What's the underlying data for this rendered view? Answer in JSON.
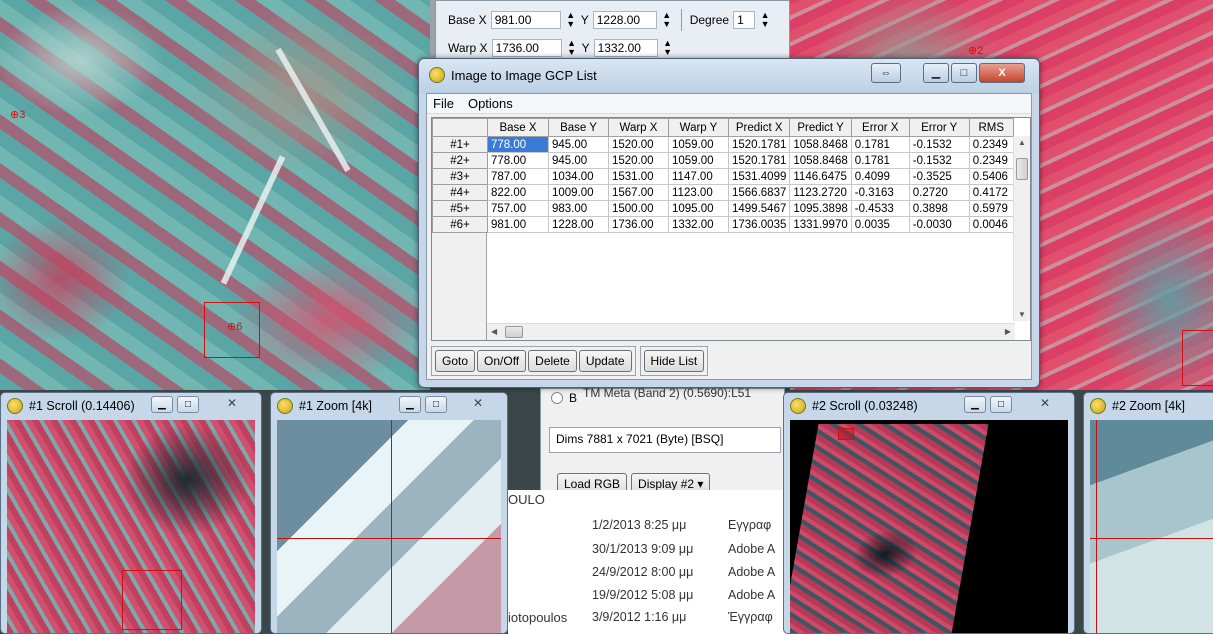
{
  "warp_dialog": {
    "base_x_label": "Base X",
    "base_x": "981.00",
    "base_y_label": "Y",
    "base_y": "1228.00",
    "degree_label": "Degree",
    "degree": "1",
    "warp_x_label": "Warp X",
    "warp_x": "1736.00",
    "warp_y_label": "Y",
    "warp_y": "1332.00"
  },
  "gcp_window": {
    "title": "Image to Image GCP List",
    "menu": [
      "File",
      "Options"
    ],
    "columns": [
      "Base X",
      "Base Y",
      "Warp X",
      "Warp Y",
      "Predict X",
      "Predict Y",
      "Error X",
      "Error Y",
      "RMS"
    ],
    "rows": [
      {
        "id": "#1+",
        "cells": [
          "778.00",
          "945.00",
          "1520.00",
          "1059.00",
          "1520.1781",
          "1058.8468",
          "0.1781",
          "-0.1532",
          "0.2349"
        ]
      },
      {
        "id": "#2+",
        "cells": [
          "778.00",
          "945.00",
          "1520.00",
          "1059.00",
          "1520.1781",
          "1058.8468",
          "0.1781",
          "-0.1532",
          "0.2349"
        ]
      },
      {
        "id": "#3+",
        "cells": [
          "787.00",
          "1034.00",
          "1531.00",
          "1147.00",
          "1531.4099",
          "1146.6475",
          "0.4099",
          "-0.3525",
          "0.5406"
        ]
      },
      {
        "id": "#4+",
        "cells": [
          "822.00",
          "1009.00",
          "1567.00",
          "1123.00",
          "1566.6837",
          "1123.2720",
          "-0.3163",
          "0.2720",
          "0.4172"
        ]
      },
      {
        "id": "#5+",
        "cells": [
          "757.00",
          "983.00",
          "1500.00",
          "1095.00",
          "1499.5467",
          "1095.3898",
          "-0.4533",
          "0.3898",
          "0.5979"
        ]
      },
      {
        "id": "#6+",
        "cells": [
          "981.00",
          "1228.00",
          "1736.00",
          "1332.00",
          "1736.0035",
          "1331.9970",
          "0.0035",
          "-0.0030",
          "0.0046"
        ]
      }
    ],
    "buttons": {
      "goto": "Goto",
      "onoff": "On/Off",
      "delete": "Delete",
      "update": "Update",
      "hide_list": "Hide List"
    }
  },
  "subwindows": {
    "scroll1": "#1 Scroll (0.14406)",
    "zoom1": "#1 Zoom [4k]",
    "scroll2": "#2 Scroll (0.03248)",
    "zoom2": "#2 Zoom [4k]"
  },
  "bands_dialog": {
    "radio_label": "B",
    "band_text": "TM Meta (Band 2) (0.5690):L51",
    "dims": "Dims 7881 x 7021 (Byte) [BSQ]",
    "load_rgb": "Load RGB",
    "display": "Display #2"
  },
  "explorer": {
    "partial_name_1": "OULO",
    "partial_name_2": "iotopoulos",
    "rows": [
      {
        "date": "1/2/2013 8:25 μμ",
        "type": "Εγγραφ"
      },
      {
        "date": "30/1/2013 9:09 μμ",
        "type": "Adobe A"
      },
      {
        "date": "24/9/2012 8:00 μμ",
        "type": "Adobe A"
      },
      {
        "date": "19/9/2012 5:08 μμ",
        "type": "Adobe A"
      },
      {
        "date": "3/9/2012 1:16 μμ",
        "type": "Έγγραφ"
      }
    ]
  },
  "gcp_marks": {
    "m6": "⊕6",
    "m3": "⊕3",
    "m2": "⊕2"
  }
}
